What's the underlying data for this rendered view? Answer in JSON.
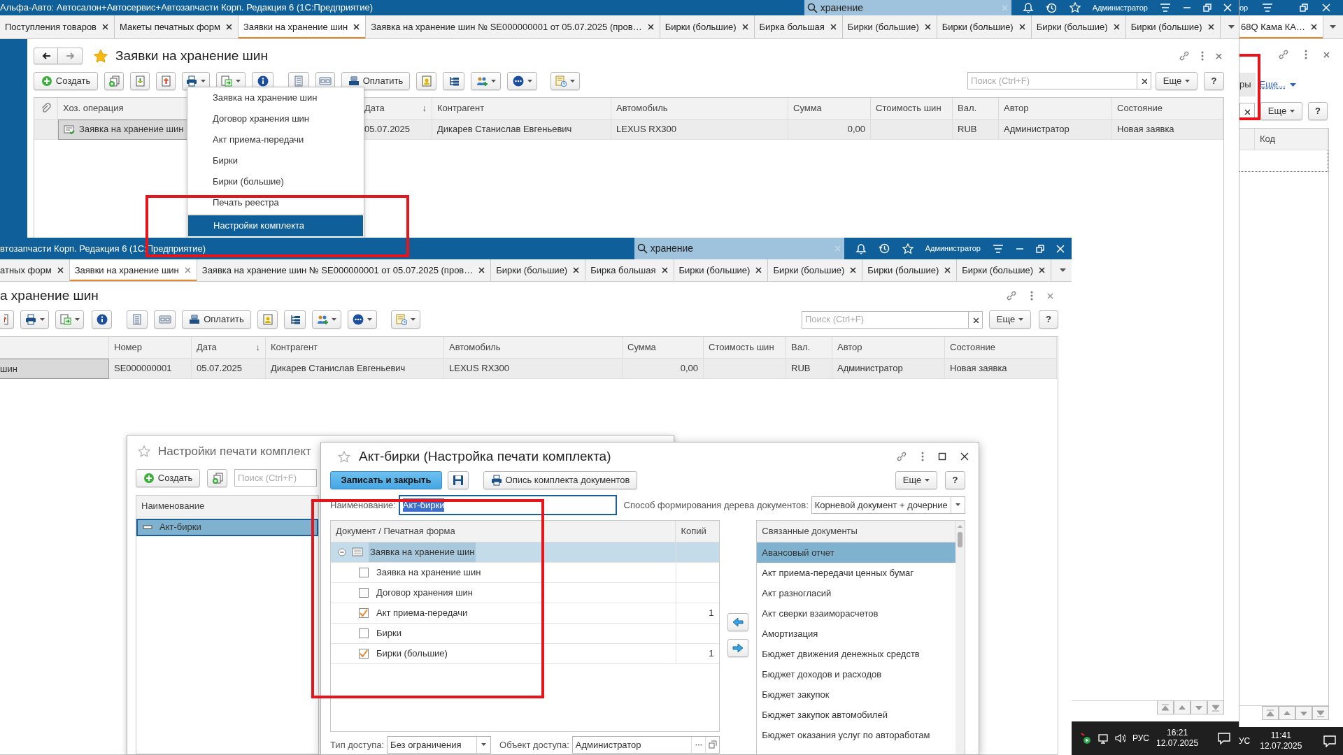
{
  "main_window": {
    "title": "Альфа-Авто: Автосалон+Автосервис+Автозапчасти Корп. Редакция 6  (1С:Предприятие)",
    "search": "хранение",
    "user": "Администратор",
    "tabs": [
      {
        "label": "Поступления товаров",
        "selected": false
      },
      {
        "label": "Макеты печатных форм",
        "selected": false
      },
      {
        "label": "Заявки на хранение шин",
        "selected": true
      },
      {
        "label": "Заявка на хранение шин № SE000000001 от 05.07.2025 (пров…",
        "selected": false
      },
      {
        "label": "Бирки (большие)",
        "selected": false
      },
      {
        "label": "Бирка большая",
        "selected": false
      },
      {
        "label": "Бирки (большие)",
        "selected": false
      },
      {
        "label": "Бирки (большие)",
        "selected": false
      },
      {
        "label": "Бирки (большие)",
        "selected": false
      },
      {
        "label": "Бирки (большие)",
        "selected": false
      }
    ],
    "page_title": "Заявки на хранение шин",
    "create": "Создать",
    "pay": "Оплатить",
    "search_placeholder": "Поиск (Ctrl+F)",
    "more": "Еще",
    "help": "?",
    "columns": [
      {
        "label": "Хоз. операция"
      },
      {
        "label": "Дата",
        "sort": "↓"
      },
      {
        "label": "Контрагент"
      },
      {
        "label": "Автомобиль"
      },
      {
        "label": "Сумма"
      },
      {
        "label": "Стоимость шин"
      },
      {
        "label": "Вал."
      },
      {
        "label": "Автор"
      },
      {
        "label": "Состояние"
      }
    ],
    "rows": [
      {
        "selected": true,
        "cells": [
          "Заявка на хранение шин",
          "05.07.2025",
          "Дикарев Станислав Евгеньевич",
          "LEXUS RX300",
          "0,00",
          null,
          "RUB",
          "Администратор",
          "Новая заявка"
        ]
      }
    ],
    "print_menu": [
      {
        "label": "Заявка на хранение шин",
        "selected": false
      },
      {
        "label": "Договор хранения шин",
        "selected": false
      },
      {
        "label": "Акт приема-передачи",
        "selected": false
      },
      {
        "label": "Бирки",
        "selected": false
      },
      {
        "label": "Бирки (большие)",
        "selected": false
      },
      {
        "label": "Печать реестра",
        "selected": false
      },
      {
        "label": "Настройки комплекта",
        "selected": true
      }
    ]
  },
  "second_window": {
    "title": "втозапчасти Корп. Редакция 6  (1С:Предприятие)",
    "search": "хранение",
    "user": "Администратор",
    "tabs": [
      {
        "label": "атных форм",
        "selected": false
      },
      {
        "label": "Заявки на хранение шин",
        "selected": true
      },
      {
        "label": "Заявка на хранение шин № SE000000001 от 05.07.2025 (пров…",
        "selected": false
      },
      {
        "label": "Бирки (большие)",
        "selected": false
      },
      {
        "label": "Бирка большая",
        "selected": false
      },
      {
        "label": "Бирки (большие)",
        "selected": false
      },
      {
        "label": "Бирки (большие)",
        "selected": false
      },
      {
        "label": "Бирки (большие)",
        "selected": false
      },
      {
        "label": "Бирки (большие)",
        "selected": false
      }
    ],
    "page_title": "а хранение шин",
    "pay": "Оплатить",
    "search_placeholder": "Поиск (Ctrl+F)",
    "more": "Еще",
    "help": "?",
    "columns": [
      {},
      {
        "label": "Номер"
      },
      {
        "label": "Дата",
        "sort": "↓"
      },
      {
        "label": "Контрагент"
      },
      {
        "label": "Автомобиль"
      },
      {
        "label": "Сумма"
      },
      {
        "label": "Стоимость шин"
      },
      {
        "label": "Вал."
      },
      {
        "label": "Автор"
      },
      {
        "label": "Состояние"
      }
    ],
    "rows": [
      {
        "selected": true,
        "cells": [
          "шин",
          "SE000000001",
          "05.07.2025",
          "Дикарев Станислав Евгеньевич",
          "LEXUS RX300",
          "0,00",
          null,
          "RUB",
          "Администратор",
          "Новая заявка"
        ]
      }
    ]
  },
  "right_window": {
    "title": "ор",
    "tabs": [
      {
        "label": "68Q Кама КА…",
        "selected": true
      }
    ],
    "button": "ры",
    "more_link": "Еще...",
    "more": "Еще",
    "help": "?",
    "columns": [
      "Код"
    ]
  },
  "kit_list_window": {
    "title": "Настройки печати комплект",
    "create": "Создать",
    "search_placeholder": "Поиск (Ctrl+F)",
    "column": "Наименование",
    "rows": [
      {
        "label": "Акт-бирки",
        "selected": true
      }
    ]
  },
  "kit_dialog": {
    "title": "Акт-бирки (Настройка печати комплекта)",
    "save_close": "Записать и закрыть",
    "inventory": "Опись комплекта документов",
    "more": "Еще",
    "help": "?",
    "name_label": "Наименование:",
    "name_value": "Акт-бирки",
    "name_highlighted": true,
    "tree_mode_label": "Способ формирования дерева документов:",
    "tree_mode": "Корневой документ + дочерние",
    "tree_columns": [
      "Документ / Печатная форма",
      "Копий"
    ],
    "tree": [
      {
        "label": "Заявка на хранение шин",
        "selected": true,
        "expanded": true,
        "children": [
          {
            "label": "Заявка на хранение шин",
            "checked": false,
            "selected": false
          },
          {
            "label": "Договор хранения шин",
            "checked": false,
            "selected": false
          },
          {
            "label": "Акт приема-передачи",
            "checked": true,
            "selected": false,
            "copies": "1"
          },
          {
            "label": "Бирки",
            "checked": false,
            "selected": false
          },
          {
            "label": "Бирки (большие)",
            "checked": true,
            "selected": false,
            "copies": "1"
          }
        ]
      }
    ],
    "related_title": "Связанные документы",
    "related": [
      {
        "label": "Авансовый отчет",
        "selected": true
      },
      {
        "label": "Акт приема-передачи ценных бумаг",
        "selected": false
      },
      {
        "label": "Акт разногласий",
        "selected": false
      },
      {
        "label": "Акт сверки взаиморасчетов",
        "selected": false
      },
      {
        "label": "Амортизация",
        "selected": false
      },
      {
        "label": "Бюджет движения денежных средств",
        "selected": false
      },
      {
        "label": "Бюджет доходов и расходов",
        "selected": false
      },
      {
        "label": "Бюджет закупок",
        "selected": false
      },
      {
        "label": "Бюджет закупок автомобилей",
        "selected": false
      },
      {
        "label": "Бюджет оказания услуг по автоработам",
        "selected": false
      }
    ],
    "access_type_label": "Тип доступа:",
    "access_type": "Без ограничения",
    "access_object_label": "Объект доступа:",
    "access_object": "Администратор"
  },
  "taskbars": [
    {
      "lang": "РУС",
      "time": "16:21",
      "date": "12.07.2025"
    },
    {
      "lang": "УС",
      "time": "11:41",
      "date": "12.07.2025"
    }
  ]
}
